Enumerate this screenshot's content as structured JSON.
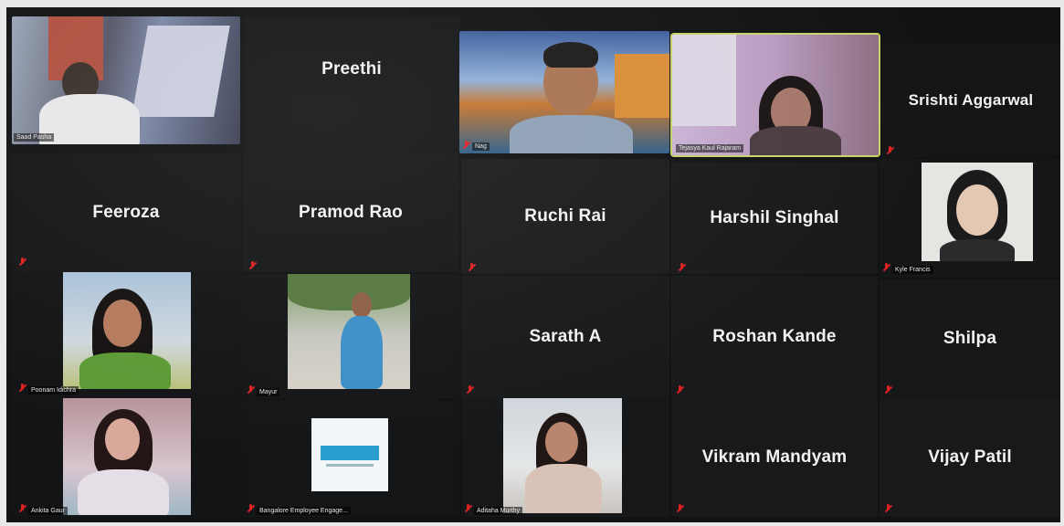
{
  "meeting": {
    "participants": [
      {
        "id": "saad",
        "name": "Saad Pasha",
        "video": true
      },
      {
        "id": "preethi",
        "name": "Preethi",
        "video": false
      },
      {
        "id": "nag",
        "name": "Nag",
        "video": true
      },
      {
        "id": "tejasya",
        "name": "Tejasya Kaul Rajaram",
        "video": true,
        "active_speaker": true
      },
      {
        "id": "srishti",
        "name": "Srishti Aggarwal",
        "video": false
      },
      {
        "id": "feeroza",
        "name": "Feeroza",
        "video": false
      },
      {
        "id": "pramod",
        "name": "Pramod Rao",
        "video": false
      },
      {
        "id": "ruchi",
        "name": "Ruchi Rai",
        "video": false
      },
      {
        "id": "harshil",
        "name": "Harshil Singhal",
        "video": false
      },
      {
        "id": "kyle",
        "name": "Kyle Francis",
        "video": true
      },
      {
        "id": "poonam",
        "name": "Poonam Idichra",
        "video": true
      },
      {
        "id": "mayur",
        "name": "Mayur",
        "video": true
      },
      {
        "id": "sarath",
        "name": "Sarath A",
        "video": false
      },
      {
        "id": "roshan",
        "name": "Roshan Kande",
        "video": false
      },
      {
        "id": "shilpa",
        "name": "Shilpa",
        "video": false
      },
      {
        "id": "ankita",
        "name": "Ankita Gaur",
        "video": true
      },
      {
        "id": "bangalore",
        "name": "Bangalore Employee Engage...",
        "video": true
      },
      {
        "id": "aditaha",
        "name": "Aditaha Murthy",
        "video": true
      },
      {
        "id": "vikram",
        "name": "Vikram Mandyam",
        "video": false
      },
      {
        "id": "vijay",
        "name": "Vijay Patil",
        "video": false
      }
    ]
  },
  "colors": {
    "tile": "#18191b",
    "mute": "#dd2222",
    "active_border": "#c8d36a"
  },
  "icons": {
    "mute": "muted-mic-icon"
  }
}
